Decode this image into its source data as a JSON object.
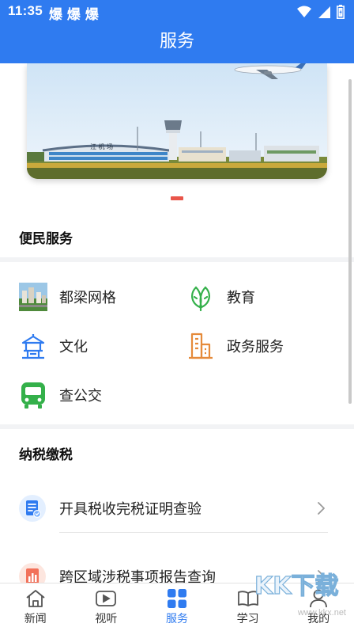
{
  "status_bar": {
    "time": "11:35",
    "notif_label": "爆 爆 爆",
    "icons": [
      "wifi-icon",
      "signal-icon",
      "battery-icon"
    ]
  },
  "header": {
    "title": "服务"
  },
  "banner": {
    "sign_text": "江 机 场",
    "page_indicator_active": 0
  },
  "convenience": {
    "title": "便民服务",
    "items": [
      {
        "label": "都梁网格",
        "icon": "city-photo-icon"
      },
      {
        "label": "教育",
        "icon": "leaf-icon"
      },
      {
        "label": "文化",
        "icon": "pavilion-icon"
      },
      {
        "label": "政务服务",
        "icon": "building-icon"
      },
      {
        "label": "查公交",
        "icon": "bus-icon"
      }
    ]
  },
  "tax": {
    "title": "纳税缴税",
    "items": [
      {
        "label": "开具税收完税证明查验",
        "icon": "certificate-icon"
      },
      {
        "label": "跨区域涉税事项报告查询",
        "icon": "report-chart-icon"
      }
    ]
  },
  "tabbar": {
    "active": "服务",
    "tabs": [
      {
        "label": "新闻",
        "icon": "home-icon"
      },
      {
        "label": "视听",
        "icon": "play-icon"
      },
      {
        "label": "服务",
        "icon": "grid-icon"
      },
      {
        "label": "学习",
        "icon": "book-icon"
      },
      {
        "label": "我的",
        "icon": "user-icon"
      }
    ]
  },
  "watermark": {
    "text": "KK下载",
    "url": "www.kkx.net"
  },
  "colors": {
    "primary": "#2f7bf0",
    "indicator": "#e9554a",
    "icon_green": "#34b04a",
    "icon_orange": "#e58a3a"
  }
}
